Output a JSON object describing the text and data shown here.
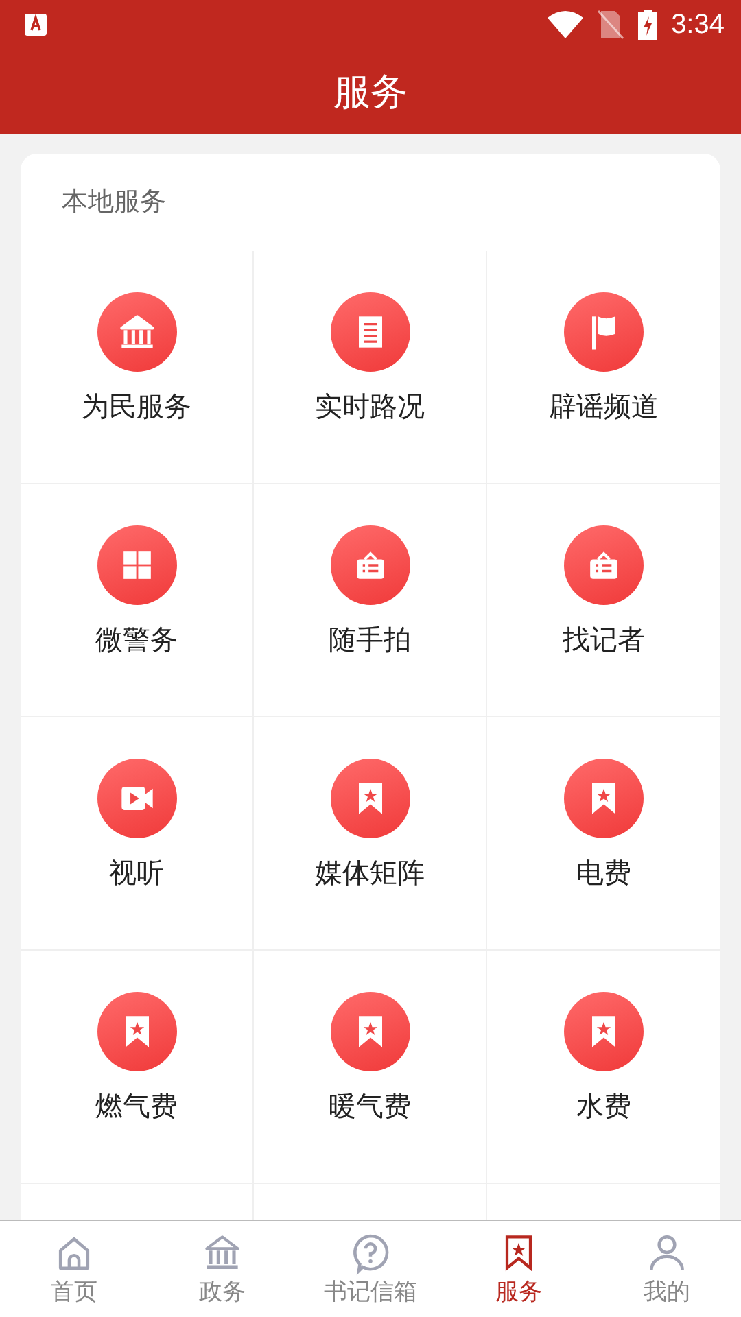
{
  "status_bar": {
    "time": "3:34"
  },
  "header": {
    "title": "服务"
  },
  "section": {
    "title": "本地服务",
    "services": [
      {
        "label": "为民服务",
        "kind": "bank"
      },
      {
        "label": "实时路况",
        "kind": "document"
      },
      {
        "label": "辟谣频道",
        "kind": "flag"
      },
      {
        "label": "微警务",
        "kind": "grid"
      },
      {
        "label": "随手拍",
        "kind": "sign"
      },
      {
        "label": "找记者",
        "kind": "sign"
      },
      {
        "label": "视听",
        "kind": "video"
      },
      {
        "label": "媒体矩阵",
        "kind": "bookmark"
      },
      {
        "label": "电费",
        "kind": "bookmark"
      },
      {
        "label": "燃气费",
        "kind": "bookmark"
      },
      {
        "label": "暖气费",
        "kind": "bookmark"
      },
      {
        "label": "水费",
        "kind": "bookmark"
      }
    ]
  },
  "tabs": [
    {
      "label": "首页",
      "kind": "home",
      "selected": false
    },
    {
      "label": "政务",
      "kind": "bank",
      "selected": false
    },
    {
      "label": "书记信箱",
      "kind": "question",
      "selected": false
    },
    {
      "label": "服务",
      "kind": "bookmark",
      "selected": true
    },
    {
      "label": "我的",
      "kind": "person",
      "selected": false
    }
  ]
}
